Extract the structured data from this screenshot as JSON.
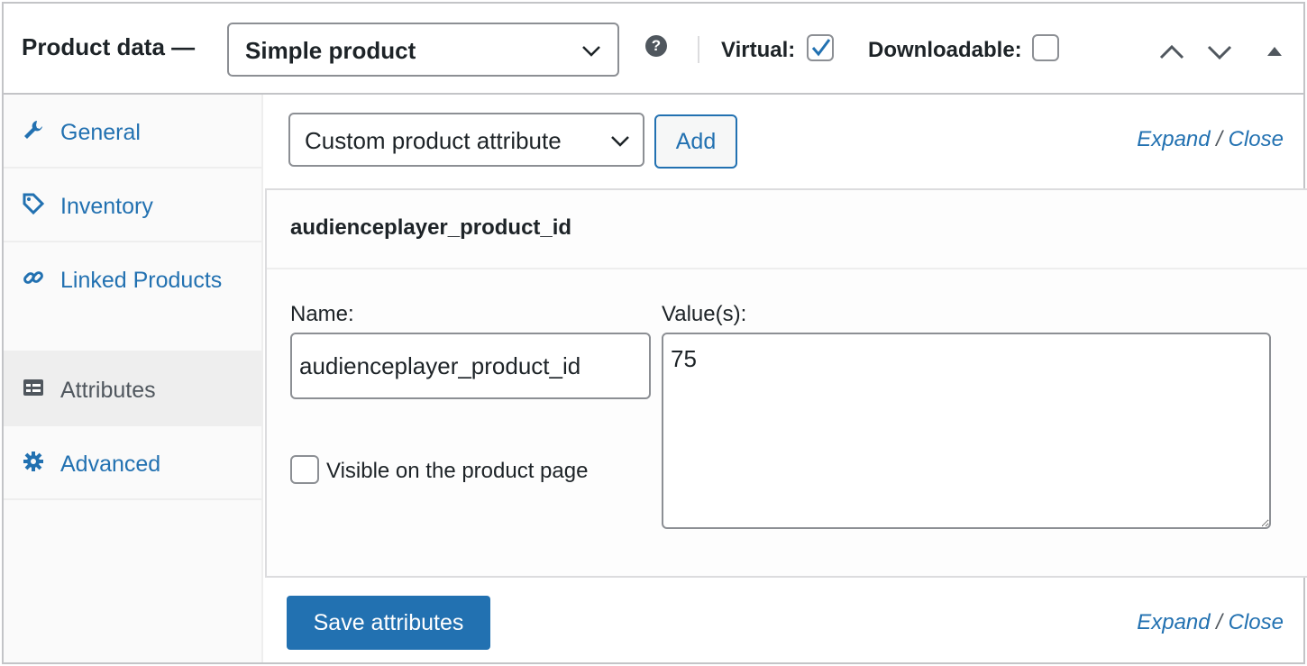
{
  "header": {
    "title": "Product data —",
    "product_type": "Simple product",
    "help": "?",
    "virtual_label": "Virtual:",
    "virtual_checked": true,
    "downloadable_label": "Downloadable:",
    "downloadable_checked": false
  },
  "sidebar": {
    "items": [
      {
        "icon": "wrench-icon",
        "label": "General",
        "active": false
      },
      {
        "icon": "tag-icon",
        "label": "Inventory",
        "active": false
      },
      {
        "icon": "link-icon",
        "label": "Linked Products",
        "active": false
      },
      {
        "icon": "table-icon",
        "label": "Attributes",
        "active": true
      },
      {
        "icon": "gear-icon",
        "label": "Advanced",
        "active": false
      }
    ]
  },
  "attributes": {
    "select_value": "Custom product attribute",
    "add_label": "Add",
    "expand_label": "Expand",
    "separator": "/",
    "close_label": "Close",
    "attribute": {
      "heading": "audienceplayer_product_id",
      "name_label": "Name:",
      "name_value": "audienceplayer_product_id",
      "values_label": "Value(s):",
      "values_value": "75",
      "visible_label": "Visible on the product page",
      "visible_checked": false
    },
    "save_label": "Save attributes"
  },
  "colors": {
    "link": "#2271b1",
    "primary_button": "#2271b1",
    "border": "#c3c4c7",
    "sidebar_bg": "#fafafa",
    "active_tab_bg": "#eeeeee"
  }
}
